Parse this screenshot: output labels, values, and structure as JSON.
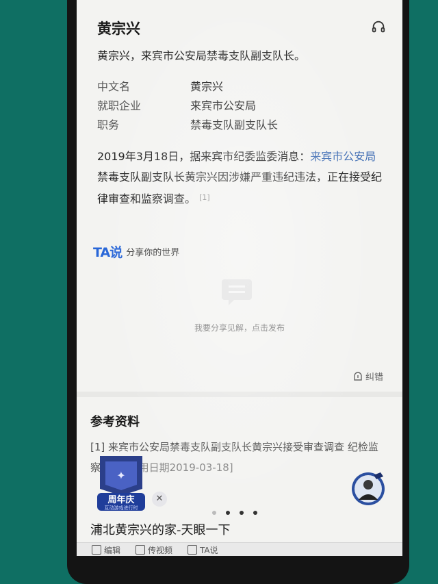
{
  "article": {
    "title": "黄宗兴",
    "summary": "黄宗兴，来宾市公安局禁毒支队副支队长。",
    "info": [
      {
        "key": "中文名",
        "value": "黄宗兴"
      },
      {
        "key": "就职企业",
        "value": "来宾市公安局"
      },
      {
        "key": "职务",
        "value": "禁毒支队副支队长"
      }
    ],
    "para_prefix": "2019年3月18日，据来宾市纪委监委消息：",
    "para_link": "来宾市公安局",
    "para_suffix": "禁毒支队副支队长黄宗兴因涉嫌严重违纪违法，正在接受纪律审查和监察调查。",
    "para_ref": "[1]"
  },
  "ta": {
    "logo": "TA说",
    "slogan": "分享你的世界",
    "share_prompt": "我要分享见解，点击发布"
  },
  "correction": {
    "label": "纠错"
  },
  "references": {
    "heading": "参考资料",
    "items": [
      {
        "index": "[1]",
        "text": "来宾市公安局禁毒支队副支队长黄宗兴接受审查调查",
        "source": "纪检监察网",
        "date": "[引用日期2019-03-18]"
      }
    ]
  },
  "promo": {
    "title": "周年庆",
    "subtitle": "互动游戏进行时",
    "close": "✕"
  },
  "carousel": {
    "active_index": 1,
    "count": 4
  },
  "news": {
    "title": "浦北黄宗兴的家-天眼一下"
  },
  "toolbar": {
    "items": [
      {
        "label": "编辑",
        "icon": "pencil-icon"
      },
      {
        "label": "传视频",
        "icon": "video-icon"
      },
      {
        "label": "TA说",
        "icon": "chat-icon"
      }
    ]
  },
  "colors": {
    "link": "#3d6bb3",
    "brand": "#2866d8",
    "background": "#0f6f63"
  }
}
